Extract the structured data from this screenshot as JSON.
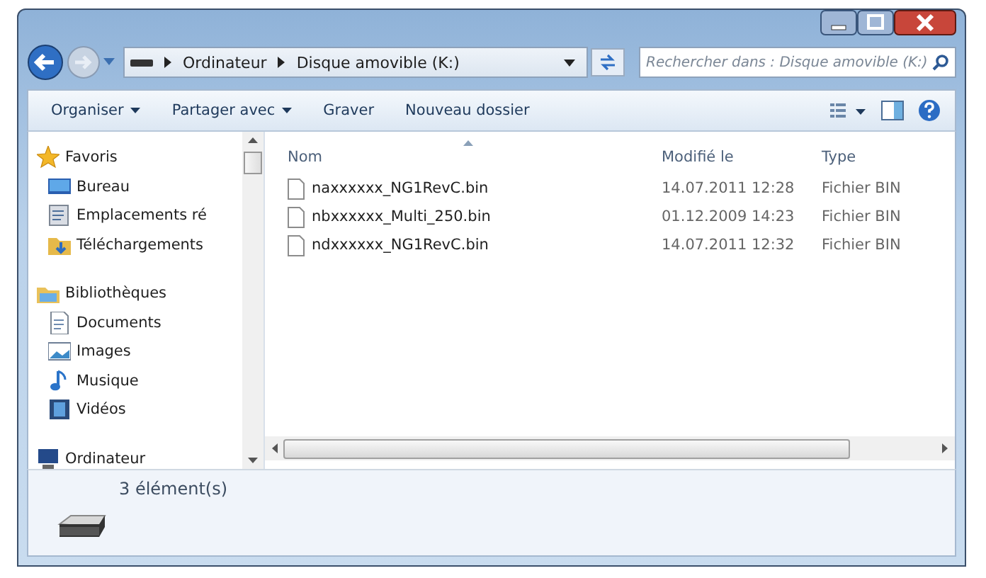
{
  "address": {
    "crumbs": [
      "Ordinateur",
      "Disque amovible (K:)"
    ]
  },
  "search": {
    "placeholder": "Rechercher dans : Disque amovible (K:)"
  },
  "toolbar": [
    {
      "label": "Organiser",
      "dropdown": true
    },
    {
      "label": "Partager avec",
      "dropdown": true
    },
    {
      "label": "Graver",
      "dropdown": false
    },
    {
      "label": "Nouveau dossier",
      "dropdown": false
    }
  ],
  "sidebar": {
    "groups": [
      {
        "label": "Favoris",
        "kind": "star",
        "children": [
          {
            "label": "Bureau",
            "kind": "desktop"
          },
          {
            "label": "Emplacements ré",
            "kind": "places"
          },
          {
            "label": "Téléchargements",
            "kind": "download"
          }
        ]
      },
      {
        "label": "Bibliothèques",
        "kind": "library",
        "children": [
          {
            "label": "Documents",
            "kind": "document"
          },
          {
            "label": "Images",
            "kind": "image"
          },
          {
            "label": "Musique",
            "kind": "music"
          },
          {
            "label": "Vidéos",
            "kind": "video"
          }
        ]
      },
      {
        "label": "Ordinateur",
        "kind": "computer"
      }
    ]
  },
  "table": {
    "columns": [
      {
        "label": "Nom",
        "sorted": true
      },
      {
        "label": "Modifié le",
        "sorted": false
      },
      {
        "label": "Type",
        "sorted": false
      }
    ],
    "rows": [
      [
        "naxxxxxx_NG1RevC.bin",
        "14.07.2011 12:28",
        "Fichier BIN"
      ],
      [
        "nbxxxxxx_Multi_250.bin",
        "01.12.2009 14:23",
        "Fichier BIN"
      ],
      [
        "ndxxxxxx_NG1RevC.bin",
        "14.07.2011 12:32",
        "Fichier BIN"
      ]
    ]
  },
  "status_bar": {
    "text": "3 élément(s)"
  }
}
